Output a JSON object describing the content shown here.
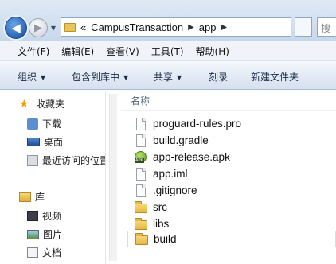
{
  "address_bar": {
    "overflow_marker": "«",
    "breadcrumbs": [
      "CampusTransaction",
      "app"
    ],
    "search_partial": "搜"
  },
  "menubar": {
    "items": [
      "文件(F)",
      "编辑(E)",
      "查看(V)",
      "工具(T)",
      "帮助(H)"
    ]
  },
  "command_bar": {
    "organize": "组织",
    "include_in_library": "包含到库中",
    "share": "共享",
    "burn": "刻录",
    "new_folder": "新建文件夹"
  },
  "navigation_pane": {
    "favorites": {
      "label": "收藏夹",
      "items": [
        "下载",
        "桌面",
        "最近访问的位置"
      ]
    },
    "libraries": {
      "label": "库",
      "items": [
        "视频",
        "图片",
        "文档"
      ]
    }
  },
  "content": {
    "column_header": "名称",
    "files": [
      {
        "name": "proguard-rules.pro",
        "icon": "file-icon"
      },
      {
        "name": "build.gradle",
        "icon": "file-icon"
      },
      {
        "name": "app-release.apk",
        "icon": "apk-icon"
      },
      {
        "name": "app.iml",
        "icon": "file-icon"
      },
      {
        "name": ".gitignore",
        "icon": "file-icon"
      },
      {
        "name": "src",
        "icon": "folder-icon"
      },
      {
        "name": "libs",
        "icon": "folder-icon"
      },
      {
        "name": "build",
        "icon": "folder-icon"
      }
    ]
  }
}
